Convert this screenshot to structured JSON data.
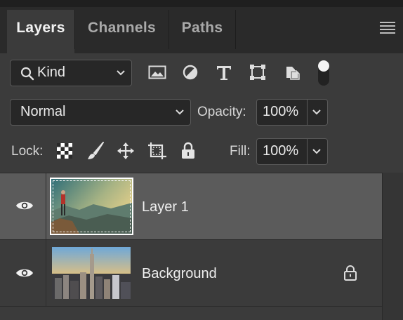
{
  "tabs": [
    {
      "label": "Layers"
    },
    {
      "label": "Channels"
    },
    {
      "label": "Paths"
    }
  ],
  "filter": {
    "kind_label": "Kind",
    "icons": [
      "image-filter-icon",
      "adjustment-filter-icon",
      "type-filter-icon",
      "shape-filter-icon",
      "smart-object-filter-icon",
      "filter-toggle-icon"
    ]
  },
  "blend": {
    "mode": "Normal",
    "opacity_label": "Opacity:",
    "opacity_value": "100%"
  },
  "lock": {
    "label": "Lock:",
    "fill_label": "Fill:",
    "fill_value": "100%"
  },
  "layers": [
    {
      "name": "Layer 1",
      "selected": true,
      "visible": true,
      "locked": false
    },
    {
      "name": "Background",
      "selected": false,
      "visible": true,
      "locked": true
    }
  ],
  "colors": {
    "panel_bg": "#3b3b3b",
    "tabbar_bg": "#2a2a2a",
    "selected_row": "#5b5b5b",
    "field_bg": "#272727"
  }
}
